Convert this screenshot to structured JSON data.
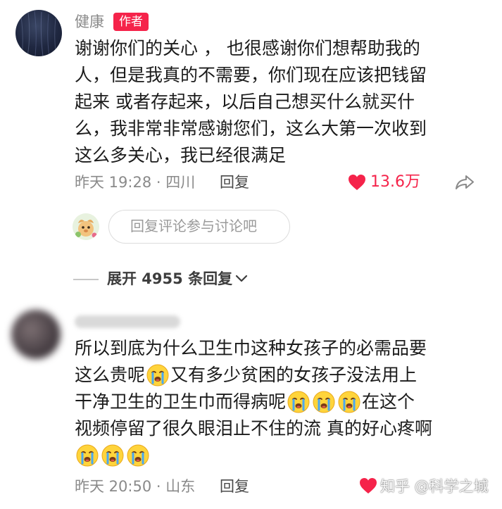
{
  "comment_main": {
    "author_name": "健康",
    "author_badge": "作者",
    "text_lines": [
      "谢谢你们的关心 ， 也很感谢你们想帮助我的",
      "人，但是我真的不需要，你们现在应该把钱留",
      "起来 或者存起来，以后自己想买什么就买什",
      "么，我非常非常感谢您们，这么大第一次收到",
      "这么多关心，我已经很满足"
    ],
    "meta": "昨天 19:28 · 四川",
    "reply_label": "回复",
    "like_count": "13.6万",
    "reply_input_placeholder": "回复评论参与讨论吧",
    "expand_label": "展开 4955 条回复"
  },
  "comment_second": {
    "text_line1": "所以到底为什么卫生巾这种女孩子的必需品要",
    "text_line2": "这么贵呢",
    "text_line2b": " 又有多少贫困的女孩子没法用上",
    "text_line3": "干净卫生的卫生巾而得病呢",
    "text_line3b": " 在这个",
    "text_line4": "视频停留了很久眼泪止不住的流  真的好心疼啊",
    "meta": "昨天 20:50 · 山东",
    "reply_label": "回复"
  },
  "emoji_name": "crying-face",
  "watermark": "知乎 @科学之城",
  "colors": {
    "accent": "#f5234a",
    "meta_gray": "#8a8a8a",
    "text": "#1b1b1b"
  }
}
